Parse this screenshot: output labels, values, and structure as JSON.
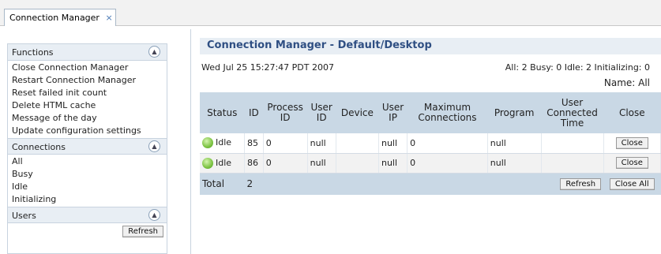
{
  "tab": {
    "label": "Connection Manager",
    "close": "×"
  },
  "functions": {
    "header": "Functions",
    "items": [
      "Close Connection Manager",
      "Restart Connection Manager",
      "Reset failed init count",
      "Delete HTML cache",
      "Message of the day",
      "Update configuration settings"
    ]
  },
  "connections": {
    "header": "Connections",
    "items": [
      "All",
      "Busy",
      "Idle",
      "Initializing"
    ]
  },
  "users": {
    "header": "Users",
    "refresh_label": "Refresh"
  },
  "main": {
    "title": "Connection Manager - Default/Desktop",
    "date": "Wed Jul 25 15:27:47 PDT 2007",
    "counts": "All: 2 Busy: 0 Idle: 2 Initializing: 0",
    "name_filter": "Name: All",
    "columns": {
      "status": "Status",
      "id": "ID",
      "process_id": "Process ID",
      "user_id": "User ID",
      "device": "Device",
      "user_ip": "User IP",
      "max_conn": "Maximum Connections",
      "program": "Program",
      "user_connected": "User Connected Time",
      "close": "Close"
    },
    "rows": [
      {
        "status": "Idle",
        "id": "85",
        "process_id": "0",
        "user_id": "null",
        "device": "",
        "user_ip": "null",
        "max_conn": "0",
        "program": "null",
        "user_connected": "",
        "close": "Close"
      },
      {
        "status": "Idle",
        "id": "86",
        "process_id": "0",
        "user_id": "null",
        "device": "",
        "user_ip": "null",
        "max_conn": "0",
        "program": "null",
        "user_connected": "",
        "close": "Close"
      }
    ],
    "total_label": "Total",
    "total_value": "2",
    "refresh_label": "Refresh",
    "close_all_label": "Close All"
  },
  "colors": {
    "accent": "#2f4f83",
    "header_bg": "#c9d8e5",
    "section_bg": "#e8eef4"
  }
}
